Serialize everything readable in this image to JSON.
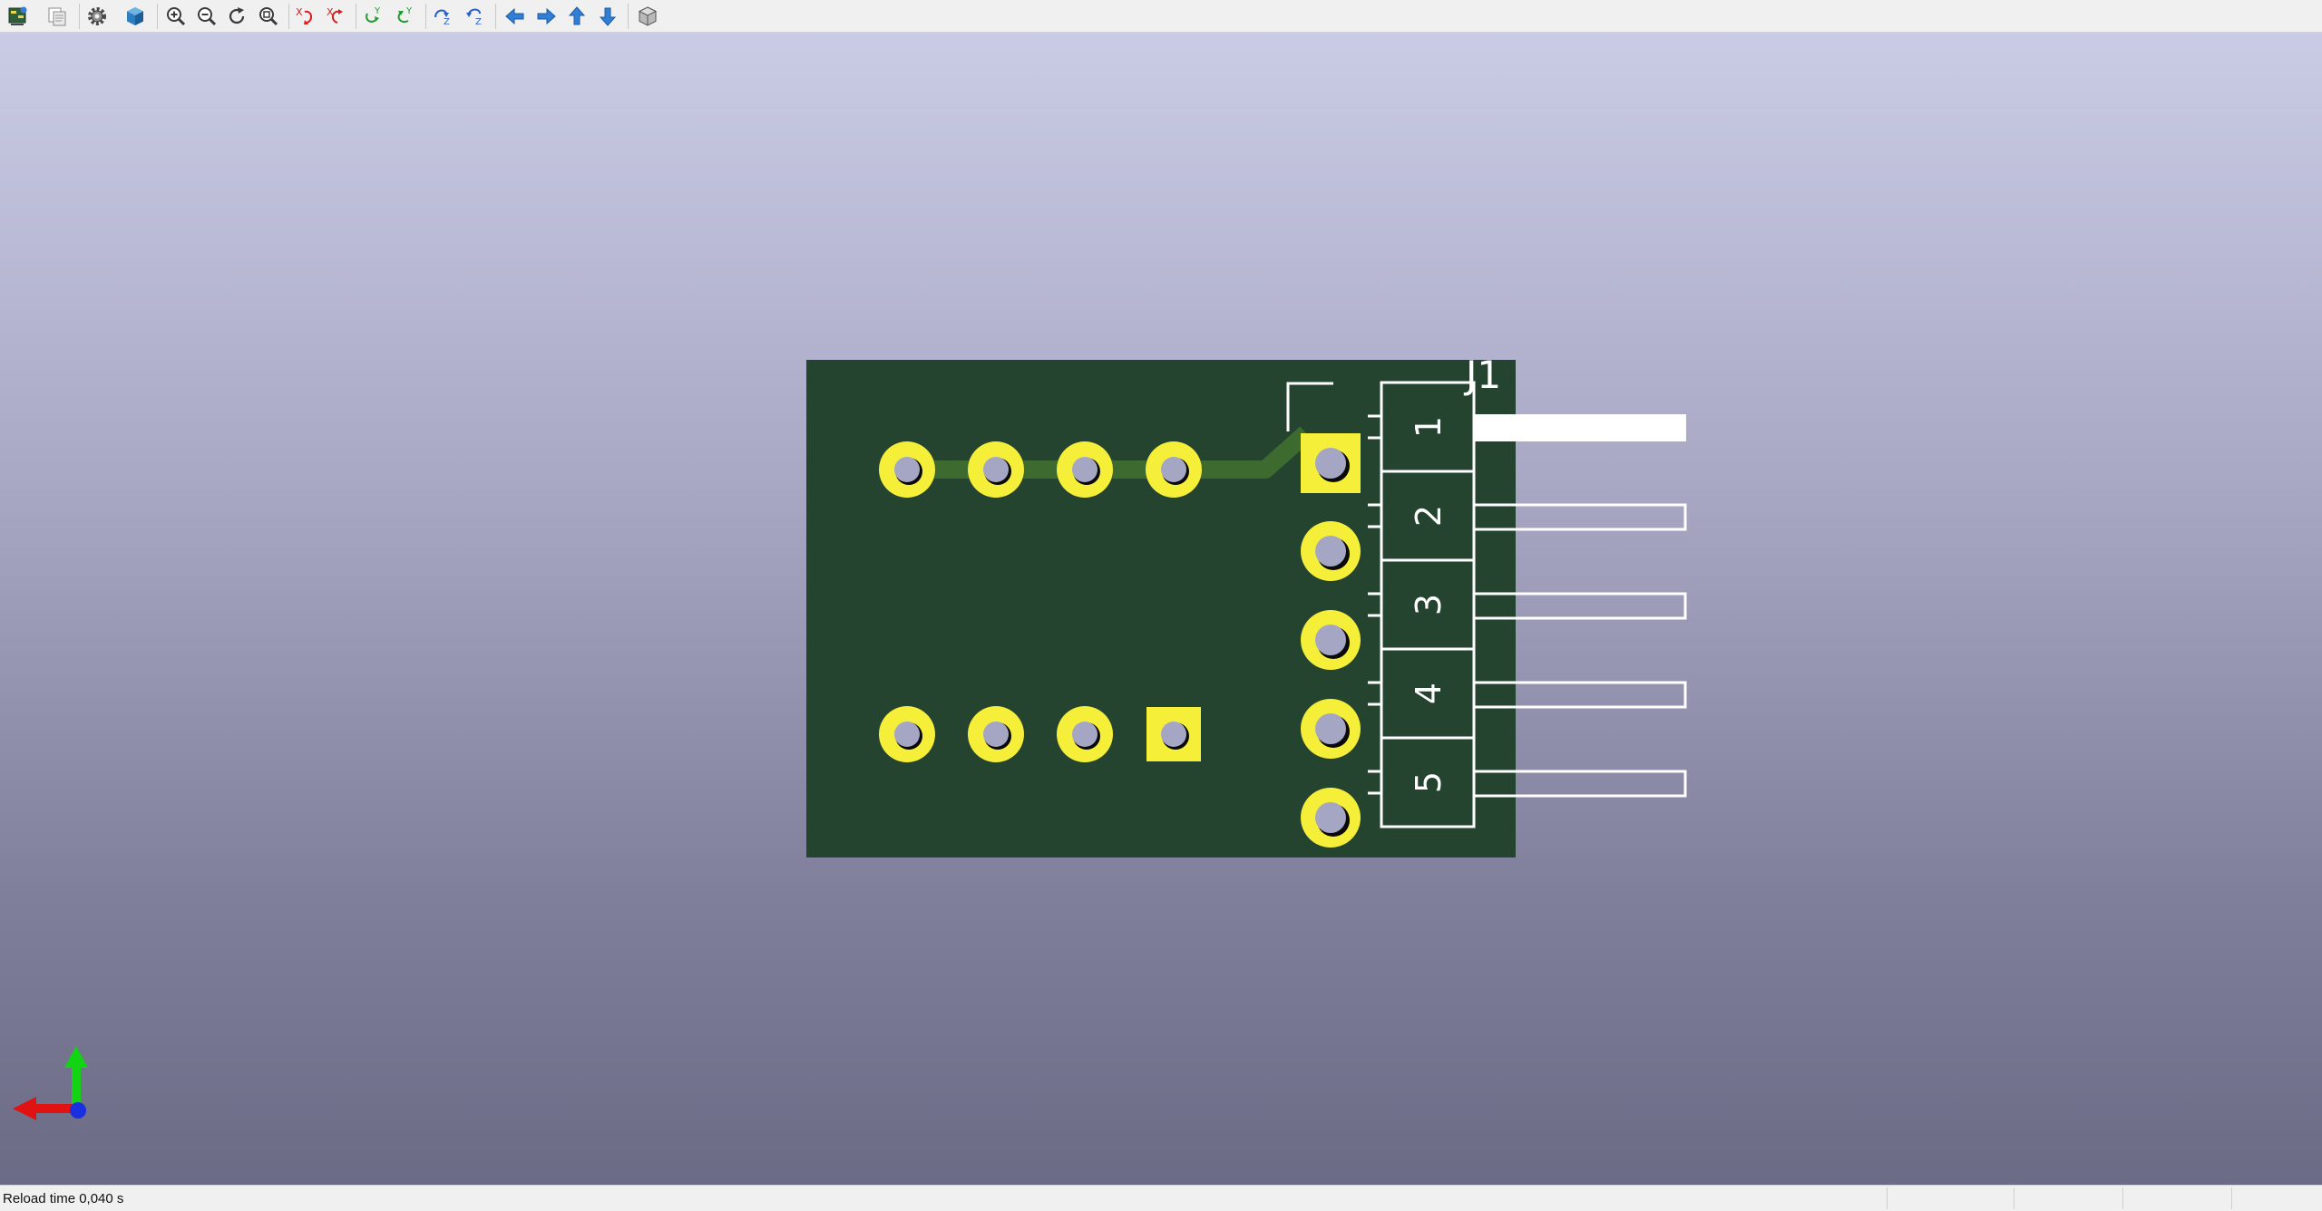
{
  "toolbar": {
    "buttons": [
      {
        "icon": "reload-board-icon"
      },
      {
        "icon": "copy-image-icon"
      },
      {
        "icon": "settings-gear-icon"
      },
      {
        "icon": "raytracing-cube-icon"
      },
      {
        "icon": "zoom-in-icon"
      },
      {
        "icon": "zoom-out-icon"
      },
      {
        "icon": "redraw-icon"
      },
      {
        "icon": "zoom-fit-icon"
      },
      {
        "icon": "rotate-x-cw-icon"
      },
      {
        "icon": "rotate-x-ccw-icon"
      },
      {
        "icon": "rotate-y-cw-icon"
      },
      {
        "icon": "rotate-y-ccw-icon"
      },
      {
        "icon": "rotate-z-cw-icon"
      },
      {
        "icon": "rotate-z-ccw-icon"
      },
      {
        "icon": "move-left-icon"
      },
      {
        "icon": "move-right-icon"
      },
      {
        "icon": "move-up-icon"
      },
      {
        "icon": "move-down-icon"
      },
      {
        "icon": "ortho-view-cube-icon"
      }
    ]
  },
  "board": {
    "colors": {
      "substrate": "#244430",
      "copper": "#f5ef3a",
      "trace": "#3d6b2f",
      "silkscreen": "#ffffff",
      "hole": "#a5a5c4"
    },
    "reference": "J1",
    "pin_labels": [
      "1",
      "2",
      "3",
      "4",
      "5"
    ]
  },
  "status": {
    "text": "Reload time 0,040 s"
  }
}
